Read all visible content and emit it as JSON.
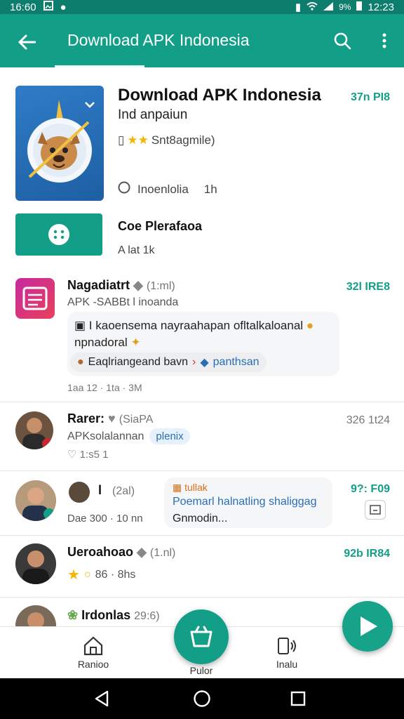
{
  "status_bar": {
    "left_time": "16:60",
    "right_battery": "9%",
    "right_time": "12:23"
  },
  "app_bar": {
    "title": "Download APK Indonesia"
  },
  "hero": {
    "title": "Download APK Indonesia",
    "subtitle": "Ind anpaiun",
    "rating_text": "Snt8agmile)",
    "price": "37n PI8",
    "meta_label": "Inoenlolia",
    "meta_count": "1h",
    "install_label": "Coe Plerafaoa",
    "install_size": "A lat  1k"
  },
  "feed": [
    {
      "name": "Nagadiatrt",
      "suffix": "(1:ml)",
      "sub": "APK -SABBt l inoanda",
      "price": "32l IRE8",
      "message_line1": "I kaoensema nayraahapan  ofltalkaloanal",
      "message_line2": "npnadoral",
      "chip_left": "Eaqlriangeand bavn",
      "chip_right": "panthsan",
      "timestamp": "1aa 12 · 1ta · 3M"
    },
    {
      "name": "Rarer:",
      "suffix": "(SiaPA",
      "sub": "APKsolalannan",
      "chip": "plenix",
      "footer": "1:s5 1",
      "price": "326 1t24"
    },
    {
      "name": "l",
      "suffix": "(2al)",
      "meta": "Dae 300 ·  10 nn",
      "bubble_tag": "tullak",
      "bubble_line1": "Poemarl halnatling shaliggag",
      "bubble_line2": "Gnmodin...",
      "price": "9?: F09"
    },
    {
      "name": "Ueroahoao",
      "suffix": "(1.nl)",
      "rating": "86 · 8hs",
      "price": "92b IR84"
    },
    {
      "name": "Irdonlas",
      "suffix": "29:6)"
    }
  ],
  "bottom_nav": [
    {
      "label": "Ranioo"
    },
    {
      "label": "Pulor"
    },
    {
      "label": "Inalu"
    }
  ],
  "colors": {
    "primary": "#139e88",
    "status_bar": "#0d7d6e",
    "link": "#2a6fb5"
  }
}
